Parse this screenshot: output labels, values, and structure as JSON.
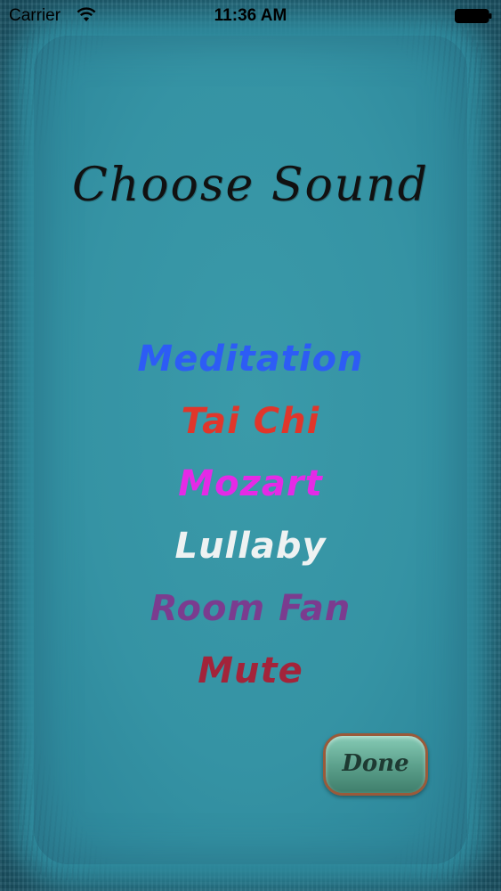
{
  "status_bar": {
    "carrier": "Carrier",
    "time": "11:36 AM",
    "wifi_icon": "wifi-icon",
    "battery_icon": "battery-icon"
  },
  "title": "Choose Sound",
  "sounds": [
    {
      "label": "Meditation",
      "color": "#2d5cf5"
    },
    {
      "label": "Tai Chi",
      "color": "#e0362b"
    },
    {
      "label": "Mozart",
      "color": "#e42ae6"
    },
    {
      "label": "Lullaby",
      "color": "#eef2f2"
    },
    {
      "label": "Room Fan",
      "color": "#7b3c8f"
    },
    {
      "label": "Mute",
      "color": "#a3243a"
    }
  ],
  "done_label": "Done"
}
